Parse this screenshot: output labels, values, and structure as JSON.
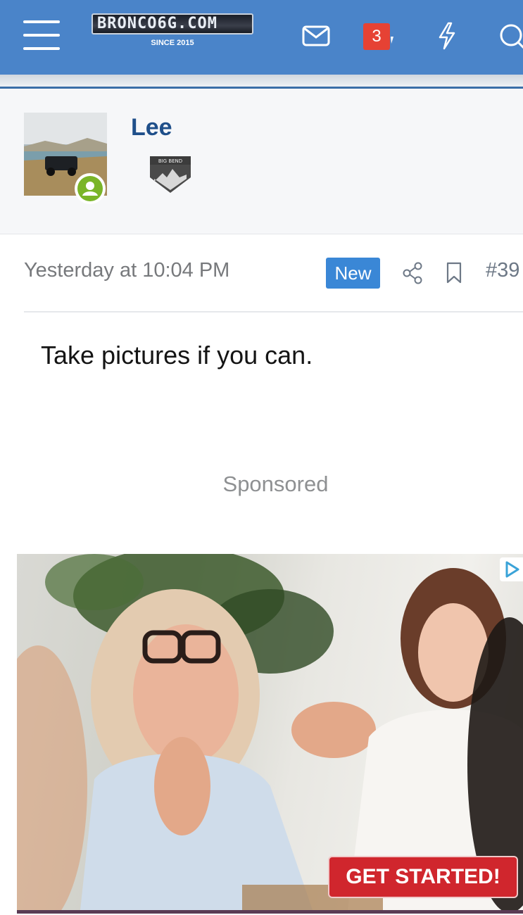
{
  "header": {
    "logo_text": "BRONCO6G.COM",
    "logo_since": "SINCE 2015",
    "alerts_count": "3",
    "icons": [
      "menu-icon",
      "envelope-icon",
      "alerts-badge",
      "lightning-icon",
      "search-icon"
    ]
  },
  "profile": {
    "username": "Lee",
    "badge_text": "BIG BEND",
    "status": "online"
  },
  "post": {
    "timestamp": "Yesterday at 10:04 PM",
    "new_label": "New",
    "post_number": "#39",
    "body": "Take pictures if you can."
  },
  "ad": {
    "sponsored_label": "Sponsored",
    "cta_label": "GET STARTED!"
  },
  "colors": {
    "header_bg": "#4a84c9",
    "username": "#1f4f8a",
    "new_badge": "#3a87d6",
    "alerts_badge": "#e64234",
    "cta": "#d0262d",
    "online": "#7ab528"
  }
}
